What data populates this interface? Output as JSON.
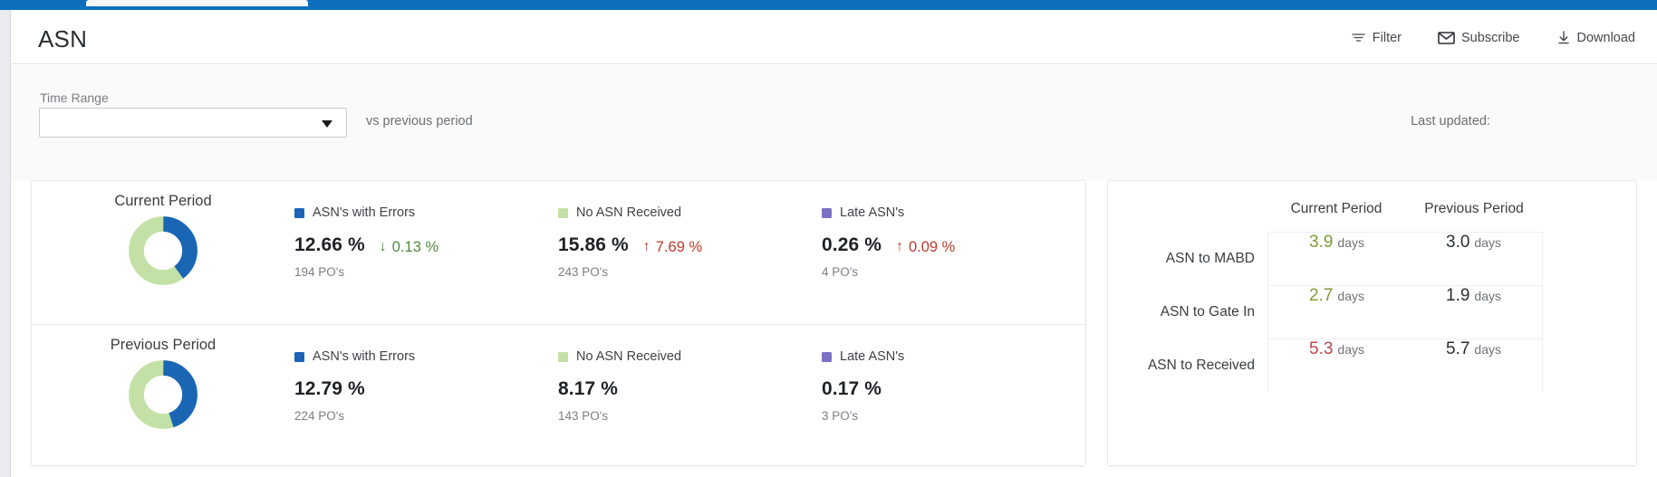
{
  "header": {
    "title": "ASN",
    "actions": [
      {
        "label": "Filter",
        "icon": "filter-icon"
      },
      {
        "label": "Subscribe",
        "icon": "envelope-icon"
      },
      {
        "label": "Download",
        "icon": "download-icon"
      }
    ]
  },
  "filters": {
    "time_range_label": "Time Range",
    "time_range_value": "",
    "compare_label": "vs previous period",
    "last_updated_label": "Last updated:"
  },
  "colors": {
    "accent_blue": "#0c6ebd",
    "series_errors": "#1a66b5",
    "series_no_asn": "#c3e1a6",
    "series_late": "#7b71c4",
    "delta_up": "#c0392b",
    "delta_down": "#4e8a3f",
    "table_good": "#7e9c3a",
    "table_bad": "#b8474a"
  },
  "periods": [
    {
      "title": "Current Period",
      "donut": {
        "errors_pct": 40,
        "no_asn_pct": 60
      },
      "metrics": [
        {
          "name": "ASN's with Errors",
          "swatch_color": "#1a66b5",
          "value": "12.66 %",
          "delta": "0.13 %",
          "delta_direction": "down",
          "delta_arrow": "↓",
          "sub": "194 PO's"
        },
        {
          "name": "No ASN Received",
          "swatch_color": "#c3e1a6",
          "value": "15.86 %",
          "delta": "7.69 %",
          "delta_direction": "up",
          "delta_arrow": "↑",
          "sub": "243 PO's"
        },
        {
          "name": "Late ASN's",
          "swatch_color": "#7b71c4",
          "value": "0.26 %",
          "delta": "0.09 %",
          "delta_direction": "up",
          "delta_arrow": "↑",
          "sub": "4 PO's"
        }
      ]
    },
    {
      "title": "Previous Period",
      "donut": {
        "errors_pct": 45,
        "no_asn_pct": 55
      },
      "metrics": [
        {
          "name": "ASN's with Errors",
          "swatch_color": "#1a66b5",
          "value": "12.79 %",
          "delta": "",
          "delta_direction": "none",
          "delta_arrow": "",
          "sub": "224 PO's"
        },
        {
          "name": "No ASN Received",
          "swatch_color": "#c3e1a6",
          "value": "8.17 %",
          "delta": "",
          "delta_direction": "none",
          "delta_arrow": "",
          "sub": "143 PO's"
        },
        {
          "name": "Late ASN's",
          "swatch_color": "#7b71c4",
          "value": "0.17 %",
          "delta": "",
          "delta_direction": "none",
          "delta_arrow": "",
          "sub": "3 PO's"
        }
      ]
    }
  ],
  "cycle_table": {
    "columns": [
      "Current Period",
      "Previous Period"
    ],
    "rows": [
      {
        "label": "ASN to MABD",
        "current": "3.9",
        "current_state": "good",
        "previous": "3.0",
        "unit": "days"
      },
      {
        "label": "ASN to Gate In",
        "current": "2.7",
        "current_state": "good",
        "previous": "1.9",
        "unit": "days"
      },
      {
        "label": "ASN to Received",
        "current": "5.3",
        "current_state": "bad",
        "previous": "5.7",
        "unit": "days"
      }
    ]
  },
  "chart_data": [
    {
      "type": "pie",
      "title": "Current Period",
      "labels": [
        "ASN's with Errors",
        "No ASN Received"
      ],
      "values": [
        40,
        60
      ],
      "colors": [
        "#1a66b5",
        "#c3e1a6"
      ],
      "legend": "right",
      "annotations": [
        "12.66 % / 194 PO's",
        "15.86 % / 243 PO's"
      ]
    },
    {
      "type": "pie",
      "title": "Previous Period",
      "labels": [
        "ASN's with Errors",
        "No ASN Received"
      ],
      "values": [
        45,
        55
      ],
      "colors": [
        "#1a66b5",
        "#c3e1a6"
      ],
      "legend": "right",
      "annotations": [
        "12.79 % / 224 PO's",
        "8.17 % / 143 PO's"
      ]
    },
    {
      "type": "table",
      "title": "ASN cycle times",
      "columns": [
        "",
        "Current Period",
        "Previous Period"
      ],
      "rows": [
        [
          "ASN to MABD",
          "3.9 days",
          "3.0 days"
        ],
        [
          "ASN to Gate In",
          "2.7 days",
          "1.9 days"
        ],
        [
          "ASN to Received",
          "5.3 days",
          "5.7 days"
        ]
      ]
    }
  ]
}
